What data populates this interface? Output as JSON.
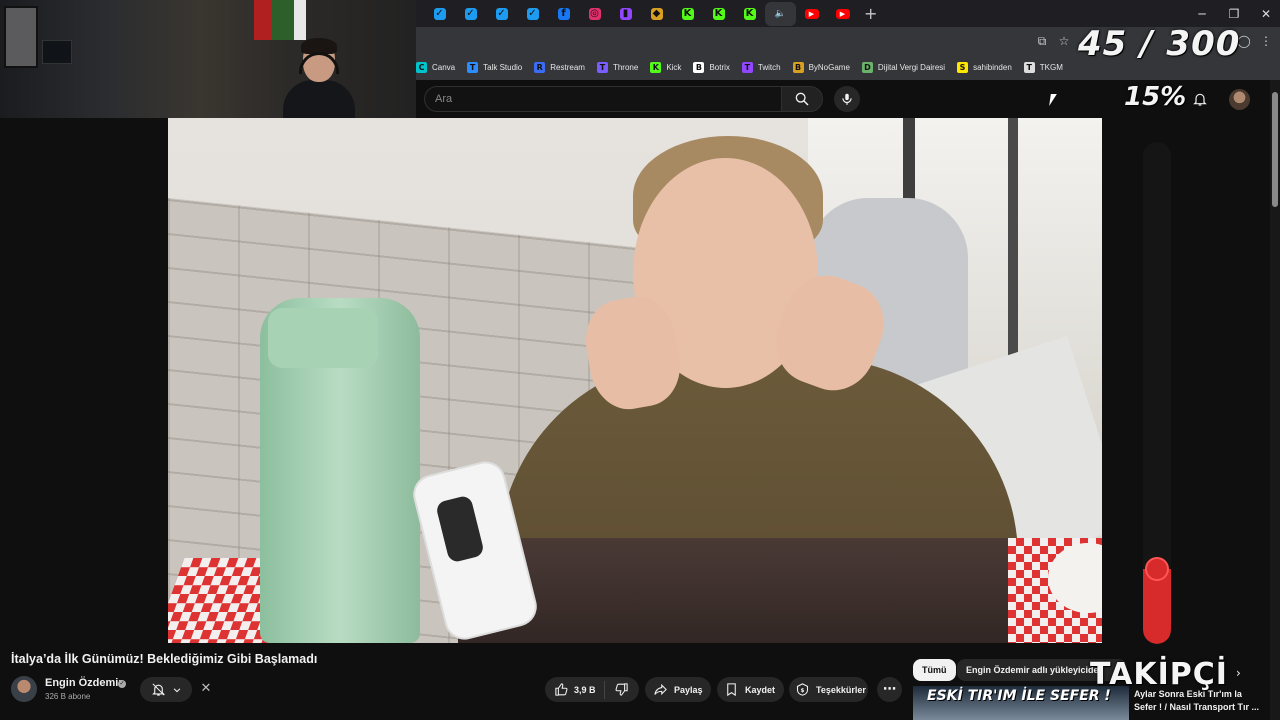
{
  "browser": {
    "tabs": [
      {
        "icon": "twitter-icon",
        "color": "#1d9bf0"
      },
      {
        "icon": "twitter-icon",
        "color": "#1d9bf0"
      },
      {
        "icon": "twitter-icon",
        "color": "#1d9bf0"
      },
      {
        "icon": "twitter-icon",
        "color": "#1d9bf0"
      },
      {
        "icon": "facebook-icon",
        "color": "#1877f2"
      },
      {
        "icon": "instagram-icon",
        "color": "#e1306c"
      },
      {
        "icon": "twitch-icon",
        "color": "#9146ff"
      },
      {
        "icon": "bynogame-icon",
        "color": "#d8a020"
      },
      {
        "icon": "kick-icon",
        "color": "#53fc18"
      },
      {
        "icon": "kick-icon",
        "color": "#53fc18"
      },
      {
        "icon": "kick-icon",
        "color": "#53fc18"
      },
      {
        "icon": "speaker-icon",
        "color": "#cccccc"
      },
      {
        "icon": "youtube-icon",
        "color": "#ff0000"
      },
      {
        "icon": "youtube-icon",
        "color": "#ff0000"
      }
    ],
    "new_tab_symbol": "+",
    "bookmarks": [
      {
        "label": "Canva",
        "icon": "canva-icon",
        "color": "#00c4cc"
      },
      {
        "label": "Talk Studio",
        "icon": "talkstudio-icon",
        "color": "#2d8cff"
      },
      {
        "label": "Restream",
        "icon": "restream-icon",
        "color": "#3b6cf6"
      },
      {
        "label": "Throne",
        "icon": "throne-icon",
        "color": "#7a5cff"
      },
      {
        "label": "Kick",
        "icon": "kick-icon",
        "color": "#53fc18"
      },
      {
        "label": "Botrix",
        "icon": "botrix-icon",
        "color": "#ffffff"
      },
      {
        "label": "Twitch",
        "icon": "twitch-icon",
        "color": "#9146ff"
      },
      {
        "label": "ByNoGame",
        "icon": "bynogame-icon",
        "color": "#d8a020"
      },
      {
        "label": "Dijital Vergi Dairesi",
        "icon": "gib-icon",
        "color": "#6bb36b"
      },
      {
        "label": "sahibinden",
        "icon": "sahibinden-icon",
        "color": "#ffe800"
      },
      {
        "label": "TKGM",
        "icon": "location-icon",
        "color": "#dddddd"
      }
    ]
  },
  "youtube": {
    "search_placeholder": "Ara",
    "video_title": "İtalya’da İlk Günümüz! Beklediğimiz Gibi Başlamadı",
    "channel_name": "Engin Özdemir",
    "subscribers": "326 B abone",
    "like_count": "3,9 B",
    "share_label": "Paylaş",
    "save_label": "Kaydet",
    "thanks_label": "Teşekkürler",
    "chips": {
      "all": "Tümü",
      "uploaded_by": "Engin Özdemir adlı yükleyiciden"
    },
    "recommendation": {
      "thumb_text": "ESKİ TIR'IM İLE SEFER !",
      "title": "Aylar Sonra Eski Tır'ım la Sefer ! / Nasıl Transport Tır ..."
    }
  },
  "overlay": {
    "follower_count_text": "45 / 300",
    "percent_text": "15%",
    "progress": 0.15,
    "label": "TAKİPÇİ",
    "gauge_color": "#d72a2a"
  }
}
